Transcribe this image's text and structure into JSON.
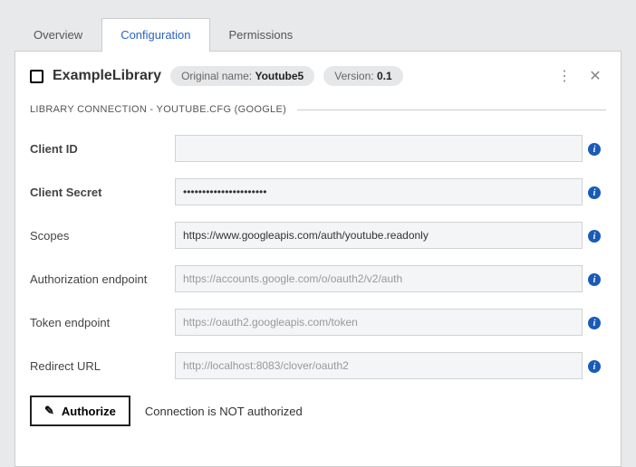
{
  "tabs": {
    "overview": "Overview",
    "configuration": "Configuration",
    "permissions": "Permissions"
  },
  "header": {
    "title": "ExampleLibrary",
    "originalNameLabel": "Original name:",
    "originalNameValue": "Youtube5",
    "versionLabel": "Version:",
    "versionValue": "0.1"
  },
  "section": {
    "title": "LIBRARY CONNECTION - YOUTUBE.CFG (GOOGLE)"
  },
  "fields": {
    "clientId": {
      "label": "Client ID",
      "value": ""
    },
    "clientSecret": {
      "label": "Client Secret",
      "value": "••••••••••••••••••••••"
    },
    "scopes": {
      "label": "Scopes",
      "value": "https://www.googleapis.com/auth/youtube.readonly"
    },
    "authEndpoint": {
      "label": "Authorization endpoint",
      "value": "https://accounts.google.com/o/oauth2/v2/auth"
    },
    "tokenEndpoint": {
      "label": "Token endpoint",
      "value": "https://oauth2.googleapis.com/token"
    },
    "redirectUrl": {
      "label": "Redirect URL",
      "value": "http://localhost:8083/clover/oauth2"
    }
  },
  "authorize": {
    "button": "Authorize",
    "status": "Connection is NOT authorized"
  }
}
